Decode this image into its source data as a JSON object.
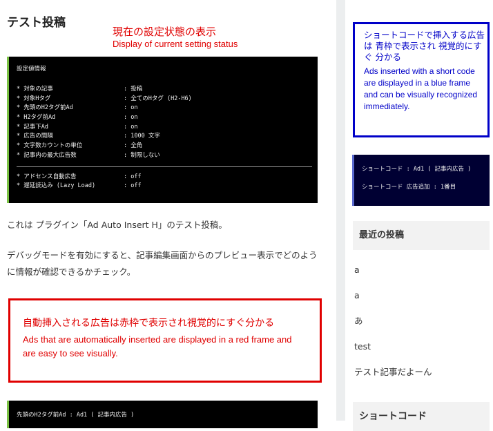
{
  "post": {
    "title": "テスト投稿",
    "paragraph1": "これは プラグイン「Ad Auto Insert H」のテスト投稿。",
    "paragraph2": "デバッグモードを有効にすると、記事編集画面からのプレビュー表示でどのように情報が確認できるかチェック。"
  },
  "annotations": {
    "status_jp": "現在の設定状態の表示",
    "status_en": "Display of current setting status",
    "red_ad_jp": "自動挿入される広告は赤枠で表示され視覚的にすぐ分かる",
    "red_ad_en": "Ads that are automatically inserted are displayed in a red frame and are easy to see visually.",
    "blue_ad_jp": "ショートコードで挿入する広告は 青枠で表示され 視覚的にすぐ 分かる",
    "blue_ad_en": "Ads inserted with a short code are displayed in a blue frame and can be visually recognized immediately."
  },
  "debug_info": {
    "heading": "設定値情報",
    "rows": [
      {
        "key": "* 対象の記事",
        "value": ": 投稿"
      },
      {
        "key": "* 対象Hタグ",
        "value": ": 全てのHタグ (H2-H6)"
      },
      {
        "key": "* 先頭のH2タグ前Ad",
        "value": ": on"
      },
      {
        "key": "* H2タグ前Ad",
        "value": ": on"
      },
      {
        "key": "* 記事下Ad",
        "value": ": on"
      },
      {
        "key": "* 広告の間隔",
        "value": ": 1000 文字"
      },
      {
        "key": "* 文字数カウントの単位",
        "value": ": 全角"
      },
      {
        "key": "* 記事内の最大広告数",
        "value": ": 制限しない"
      }
    ],
    "rows2": [
      {
        "key": "* アドセンス自動広告",
        "value": ": off"
      },
      {
        "key": "* 遅延読込み (Lazy Load)",
        "value": ": off"
      }
    ]
  },
  "debug_info2": {
    "text": "先頭のH2タグ前Ad : Ad1 ( 記事内広告 )"
  },
  "shortcode_box": {
    "line1": "ショートコード : Ad1 ( 記事内広告 )",
    "line2": "ショートコード 広告追加 : 1番目"
  },
  "sidebar": {
    "recent_title": "最近の投稿",
    "recent_posts": [
      "a",
      "a",
      "あ",
      "test",
      "テスト記事だよーん"
    ],
    "shortcode_title": "ショートコード"
  },
  "colors": {
    "annotation_red": "#e00000",
    "annotation_blue": "#0000c8",
    "debug_accent": "#7ac143"
  }
}
